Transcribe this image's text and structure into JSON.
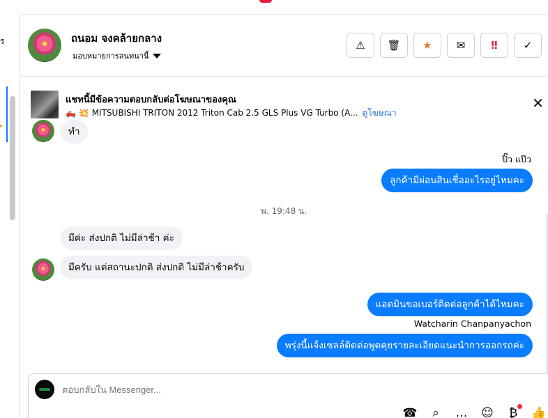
{
  "left": {
    "truncated": "ร"
  },
  "header": {
    "contact_name": "ถนอม จงคล้ายกลาง",
    "assign_label": "มอบหมายการสนทนานี้",
    "actions": [
      {
        "name": "report-spam-button",
        "icon": "⚠"
      },
      {
        "name": "delete-button",
        "icon": "🗑"
      },
      {
        "name": "star-button",
        "icon": "★",
        "color": "#e2762c"
      },
      {
        "name": "mark-unread-button",
        "icon": "✉"
      },
      {
        "name": "follow-up-button",
        "icon": "‼",
        "color": "#e41e3f"
      },
      {
        "name": "mark-done-button",
        "icon": "✓"
      }
    ]
  },
  "ad": {
    "title": "แชทนี้มีข้อความตอบกลับต่อโฆษณาของคุณ",
    "emoji": "🛻 💥",
    "text": "MITSUBISHI TRITON 2012 Triton Cab 2.5 GLS Plus VG Turbo (A...",
    "link": "ดูโฆษณา",
    "close": "✕"
  },
  "chat": {
    "partial_top": "ทำ",
    "sender_top": "ปิ๊ว แป๊ว",
    "out1": "ลูกค้ามีผ่อนสินเชื่ออะไรอยู่ไหมคะ",
    "time": "พ. 19:48 น.",
    "in1": "มีค่ะ ส่งปกติ ไม่มีล่าช้า ค่ะ",
    "in2": "มีครับ แต่สถานะปกติ ส่งปกติ ไม่มีล่าช้าครับ",
    "out2": "แอดมินขอเบอร์ติดต่อลูกค้าได้ไหมคะ",
    "sender_bottom": "Watcharin Chanpanyachon",
    "out3": "พรุ่งนี้แจ้งเซลล์ติดต่อพูดคุยรายละเอียดแนะนำการออกรถค่ะ"
  },
  "composer": {
    "placeholder": "ตอบกลับใน Messenger...",
    "tools": [
      {
        "name": "call-icon",
        "glyph": "☎"
      },
      {
        "name": "attach-icon",
        "glyph": "⌕"
      },
      {
        "name": "more-icon",
        "glyph": "…"
      },
      {
        "name": "emoji-icon",
        "glyph": "☺"
      },
      {
        "name": "saved-replies-icon",
        "glyph": "₿"
      },
      {
        "name": "like-icon",
        "glyph": "👍"
      }
    ]
  }
}
